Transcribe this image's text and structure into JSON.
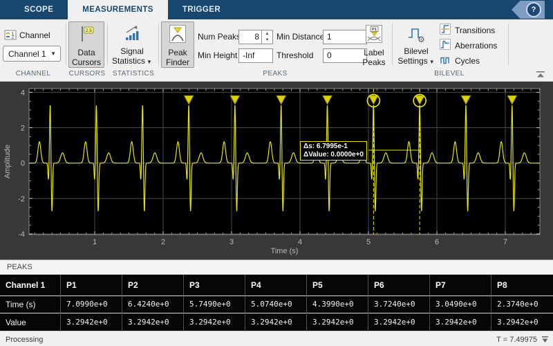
{
  "tabs": {
    "scope": "SCOPE",
    "measurements": "MEASUREMENTS",
    "trigger": "TRIGGER",
    "help": "?"
  },
  "toolstrip": {
    "channel": {
      "label": "Channel",
      "dropdown_value": "Channel 1",
      "group_label": "CHANNEL"
    },
    "cursors": {
      "line1": "Data",
      "line2": "Cursors",
      "icon_tag": "2.5",
      "group_label": "CURSORS"
    },
    "statistics": {
      "line1": "Signal",
      "line2": "Statistics",
      "group_label": "STATISTICS"
    },
    "peaks": {
      "peak_finder_line1": "Peak",
      "peak_finder_line2": "Finder",
      "num_peaks_label": "Num Peaks",
      "num_peaks_value": "8",
      "min_height_label": "Min Height",
      "min_height_value": "-Inf",
      "min_distance_label": "Min Distance",
      "min_distance_value": "1",
      "threshold_label": "Threshold",
      "threshold_value": "0",
      "label_peaks_line1": "Label",
      "label_peaks_line2": "Peaks",
      "label_peaks_icon_text": "P1",
      "group_label": "PEAKS"
    },
    "bilevel": {
      "settings_line1": "Bilevel",
      "settings_line2": "Settings",
      "transitions": "Transitions",
      "aberrations": "Aberrations",
      "cycles": "Cycles",
      "group_label": "BILEVEL"
    }
  },
  "chart_data": {
    "type": "line",
    "xlabel": "Time (s)",
    "ylabel": "Amplitude",
    "xlim": [
      0.04,
      7.505
    ],
    "ylim": [
      -4.04,
      4.21
    ],
    "x_ticks": [
      1,
      2,
      3,
      4,
      5,
      6,
      7
    ],
    "y_ticks": [
      -4,
      -2,
      0,
      2,
      4
    ],
    "x_minor_step": 0.125,
    "y_minor_step": 0.5,
    "grid": true,
    "line_color": "#e6e600",
    "background": "#000000",
    "signal": {
      "description": "ECG-like repeating pulse train",
      "beat_times": [
        0.349,
        1.024,
        1.699,
        2.374,
        3.049,
        3.724,
        4.399,
        5.074,
        5.749,
        6.424,
        7.099
      ],
      "beat_shape_components": [
        {
          "name": "P-wave",
          "amp": 1.21,
          "center": -0.158,
          "sigma": 0.021
        },
        {
          "name": "Q-dip",
          "amp": -0.95,
          "center": -0.026,
          "sigma": 0.007
        },
        {
          "name": "R-peak",
          "amp": 3.32,
          "center": 0.0,
          "sigma": 0.0085
        },
        {
          "name": "S-dip",
          "amp": -2.75,
          "center": 0.026,
          "sigma": 0.009
        },
        {
          "name": "T-wave",
          "amp": 0.58,
          "center": 0.18,
          "sigma": 0.027
        }
      ]
    },
    "marked_peaks": {
      "times": [
        2.374,
        3.049,
        3.724,
        4.399,
        5.074,
        5.749,
        6.424,
        7.099
      ],
      "value": 3.2942
    },
    "cursors": {
      "x1": 5.074,
      "x2": 5.749,
      "tooltip_lines": [
        "Δs: 6.7995e-1",
        "ΔValue: 0.0000e+0"
      ]
    }
  },
  "peaks_panel": {
    "title": "PEAKS",
    "table": {
      "header": [
        "Channel 1",
        "P1",
        "P2",
        "P3",
        "P4",
        "P5",
        "P6",
        "P7",
        "P8"
      ],
      "rows": [
        {
          "label": "Time (s)",
          "values": [
            "7.0990e+0",
            "6.4240e+0",
            "5.7490e+0",
            "5.0740e+0",
            "4.3990e+0",
            "3.7240e+0",
            "3.0490e+0",
            "2.3740e+0"
          ]
        },
        {
          "label": "Value",
          "values": [
            "3.2942e+0",
            "3.2942e+0",
            "3.2942e+0",
            "3.2942e+0",
            "3.2942e+0",
            "3.2942e+0",
            "3.2942e+0",
            "3.2942e+0"
          ]
        }
      ]
    }
  },
  "statusbar": {
    "left": "Processing",
    "right": "T = 7.49975"
  },
  "colors": {
    "accent_navy": "#17466f",
    "signal_yellow": "#e6e600",
    "marker_yellow": "#ddd104"
  }
}
